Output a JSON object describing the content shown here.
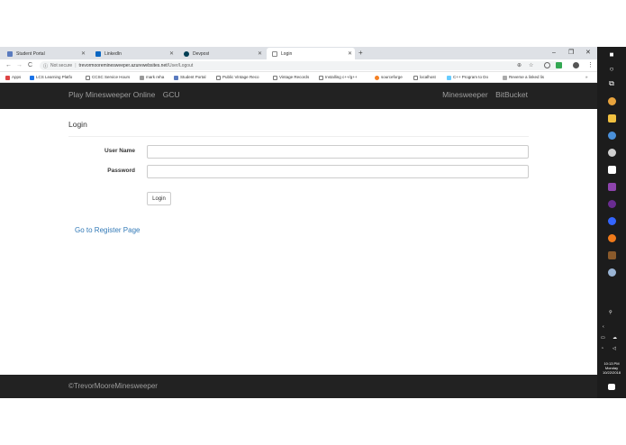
{
  "browser": {
    "tabs": [
      {
        "label": "Student Portal",
        "active": false,
        "icon_color": "#5a7bbf"
      },
      {
        "label": "LinkedIn",
        "active": false,
        "icon_color": "#0a66c2"
      },
      {
        "label": "Devpost",
        "active": false,
        "icon_color": "#003e54"
      },
      {
        "label": "Login",
        "active": true,
        "icon_color": "#888888"
      }
    ],
    "new_tab": "+",
    "window_controls": {
      "minimize": "–",
      "restore": "❐",
      "close": "✕"
    },
    "nav": {
      "back": "←",
      "forward": "→",
      "reload": "C"
    },
    "address": {
      "security": "Not secure",
      "host": "trevormooreminesweeper.azurewebsites.net",
      "path": "/User/Logout"
    },
    "bookmarks": [
      "Apps",
      "LCS Learning Platfo",
      "CCSC Service Hours",
      "mark reha",
      "Student Portal",
      "Public Vintage Reco",
      "Vintage Records",
      "Installing c++/g++",
      "sourceforge",
      "localhost",
      "C++ Program to Do",
      "Reverse a linked lis"
    ]
  },
  "site": {
    "brand": "Play Minesweeper Online",
    "brand_secondary": "GCU",
    "nav_right": [
      "Minesweeper",
      "BitBucket"
    ],
    "page_title": "Login",
    "form": {
      "username_label": "User Name",
      "username_value": "",
      "password_label": "Password",
      "password_value": "",
      "submit_label": "Login"
    },
    "register_link": "Go to Register Page",
    "footer": "©TrevorMooreMinesweeper",
    "colors": {
      "navbar": "#222222",
      "link": "#337ab7",
      "nav_text": "#9d9d9d"
    }
  },
  "taskbar": {
    "clock_time": "10:13 PM",
    "clock_day": "Monday",
    "clock_date": "10/22/2018",
    "icons": [
      "windows-icon",
      "cortana-icon",
      "task-view-icon",
      "chrome-icon",
      "file-explorer-icon",
      "app-icon",
      "app-icon",
      "mail-icon",
      "visual-studio-icon",
      "app-icon",
      "app-icon",
      "app-icon",
      "app-icon",
      "app-icon",
      "notification-icon"
    ]
  }
}
